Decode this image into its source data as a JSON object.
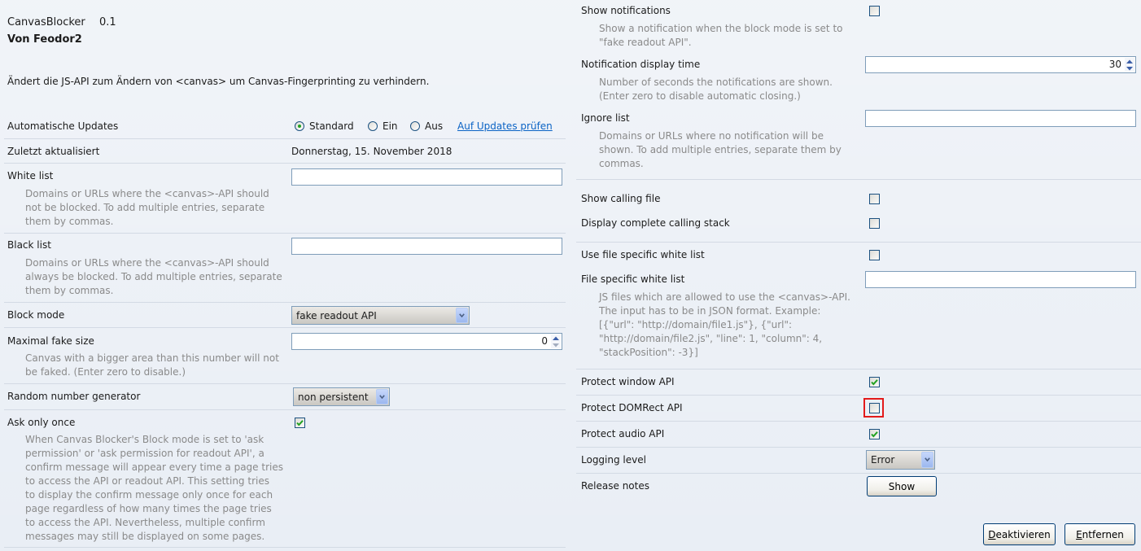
{
  "addon": {
    "name": "CanvasBlocker",
    "version": "0.1",
    "author": "Von Feodor2",
    "description": "Ändert die JS-API zum Ändern von <canvas> um Canvas-Fingerprinting zu verhindern."
  },
  "left": {
    "auto_updates": {
      "label": "Automatische Updates",
      "options": [
        {
          "label": "Standard",
          "selected": true
        },
        {
          "label": "Ein",
          "selected": false
        },
        {
          "label": "Aus",
          "selected": false
        }
      ],
      "check_link": "Auf Updates prüfen"
    },
    "last_updated": {
      "label": "Zuletzt aktualisiert",
      "value": "Donnerstag, 15. November 2018"
    },
    "white_list": {
      "label": "White list",
      "desc": [
        "Domains or URLs where the <canvas>-API should",
        "not be blocked. To add multiple entries, separate",
        "them by commas."
      ]
    },
    "black_list": {
      "label": "Black list",
      "desc": [
        "Domains or URLs where the <canvas>-API should",
        "always be blocked. To add multiple entries, separate",
        "them by commas."
      ]
    },
    "block_mode": {
      "label": "Block mode",
      "value": "fake readout API"
    },
    "max_fake_size": {
      "label": "Maximal fake size",
      "value": "0",
      "desc": [
        "Canvas with a bigger area than this number will not",
        "be faked. (Enter zero to disable.)"
      ]
    },
    "rng": {
      "label": "Random number generator",
      "value": "non persistent"
    },
    "ask_only_once": {
      "label": "Ask only once",
      "checked": true,
      "desc": [
        "When Canvas Blocker's Block mode is set to 'ask",
        "permission' or 'ask permission for readout API', a",
        "confirm message will appear every time a page tries",
        "to access the API or readout API. This setting tries",
        "to display the confirm message only once for each",
        "page regardless of how many times the page tries",
        "to access the API. Nevertheless, multiple confirm",
        "messages may still be displayed on some pages."
      ]
    }
  },
  "right": {
    "show_notifications": {
      "label": "Show notifications",
      "checked": false,
      "desc": [
        "Show a notification when the block mode is set to",
        "\"fake readout API\"."
      ]
    },
    "notification_time": {
      "label": "Notification display time",
      "value": "30",
      "desc": [
        "Number of seconds the notifications are shown.",
        "(Enter zero to disable automatic closing.)"
      ]
    },
    "ignore_list": {
      "label": "Ignore list",
      "desc": [
        "Domains or URLs where no notification will be",
        "shown. To add multiple entries, separate them by",
        "commas."
      ]
    },
    "show_calling_file": {
      "label": "Show calling file",
      "checked": false
    },
    "display_stack": {
      "label": "Display complete calling stack",
      "checked": false
    },
    "use_file_whitelist": {
      "label": "Use file specific white list",
      "checked": false
    },
    "file_whitelist": {
      "label": "File specific white list",
      "desc": [
        "JS files which are allowed to use the <canvas>-API.",
        "The input has to be in JSON format. Example:",
        "[{\"url\": \"http://domain/file1.js\"}, {\"url\":",
        "\"http://domain/file2.js\", \"line\": 1, \"column\": 4,",
        "\"stackPosition\": -3}]"
      ]
    },
    "protect_window": {
      "label": "Protect window API",
      "checked": true
    },
    "protect_domrect": {
      "label": "Protect DOMRect API",
      "checked": false,
      "highlighted": true
    },
    "protect_audio": {
      "label": "Protect audio API",
      "checked": true
    },
    "logging_level": {
      "label": "Logging level",
      "value": "Error"
    },
    "release_notes": {
      "label": "Release notes",
      "button": "Show"
    }
  },
  "footer": {
    "disable_button": "Deaktivieren",
    "remove_button": "Entfernen"
  },
  "colors": {
    "background": "#e9eef5",
    "link": "#0b63c5",
    "check": "#21a121",
    "highlight": "#e31b1b",
    "description": "#8a8a8a",
    "text": "#1b1b1b"
  },
  "icons": {
    "checkbox_mark": "checkmark-icon",
    "select_arrow": "chevron-down-icon",
    "spinner_up": "spin-up-icon",
    "spinner_down": "spin-down-icon"
  }
}
